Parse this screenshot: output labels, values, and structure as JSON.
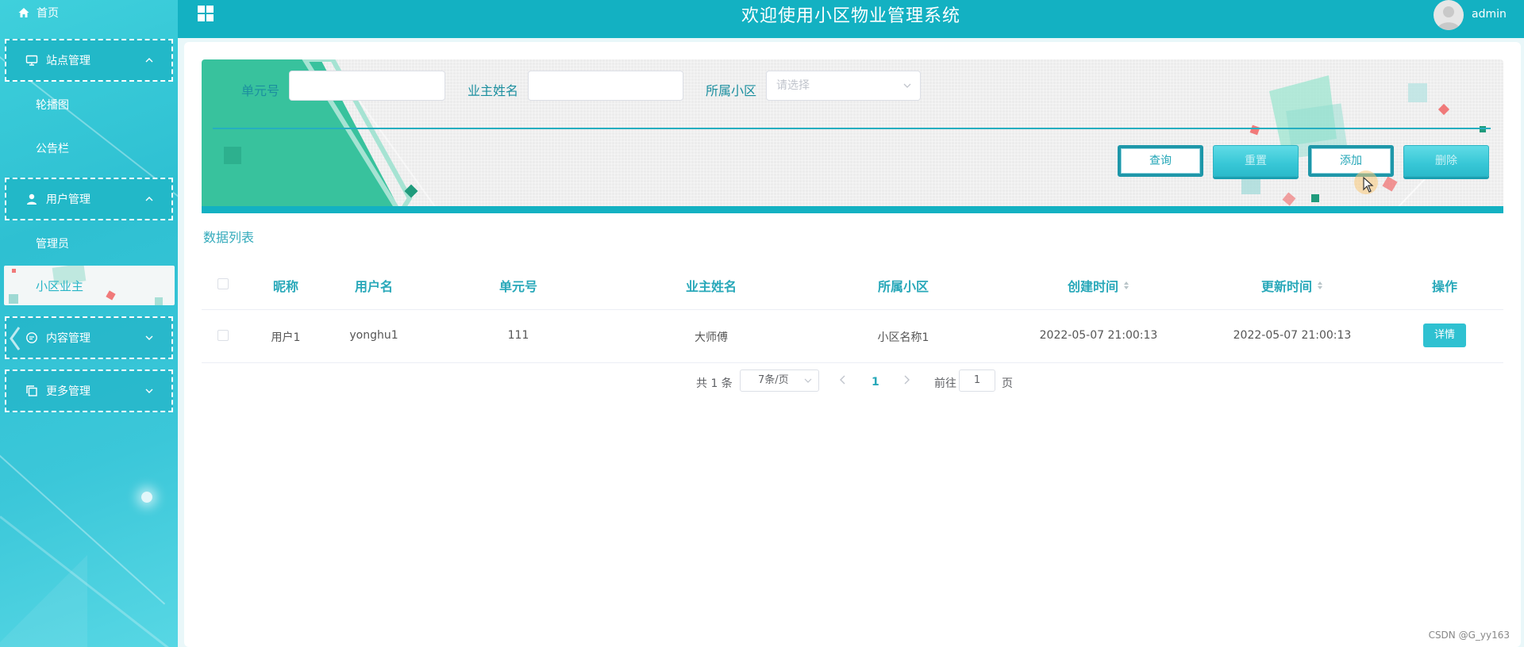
{
  "colors": {
    "primary": "#13b1c2",
    "accent": "#28a8b9",
    "sidebar_active_bg": "#f3f7f7"
  },
  "header": {
    "title": "欢迎使用小区物业管理系统",
    "username": "admin"
  },
  "sidebar": {
    "home": "首页",
    "groups": [
      {
        "label": "站点管理",
        "icon": "monitor-icon",
        "expanded": true,
        "items": [
          "轮播图",
          "公告栏"
        ]
      },
      {
        "label": "用户管理",
        "icon": "user-icon",
        "expanded": true,
        "items": [
          "管理员",
          "小区业主"
        ]
      },
      {
        "label": "内容管理",
        "icon": "chat-icon",
        "expanded": false
      },
      {
        "label": "更多管理",
        "icon": "copy-icon",
        "expanded": false
      }
    ],
    "active_item": "小区业主"
  },
  "search": {
    "fields": [
      {
        "label": "单元号",
        "value": ""
      },
      {
        "label": "业主姓名",
        "value": ""
      },
      {
        "label": "所属小区",
        "placeholder": "请选择"
      }
    ],
    "buttons": [
      "查询",
      "重置",
      "添加",
      "删除"
    ]
  },
  "list": {
    "title": "数据列表",
    "columns": [
      "昵称",
      "用户名",
      "单元号",
      "业主姓名",
      "所属小区",
      "创建时间",
      "更新时间",
      "操作"
    ],
    "rows": [
      {
        "nickname": "用户1",
        "username": "yonghu1",
        "unit": "111",
        "owner": "大师傅",
        "community": "小区名称1",
        "created": "2022-05-07 21:00:13",
        "updated": "2022-05-07 21:00:13",
        "action": "详情"
      }
    ]
  },
  "pagination": {
    "total": "共 1 条",
    "page_size": "7条/页",
    "current": "1",
    "goto_label": "前往",
    "goto_value": "1",
    "page_unit": "页"
  },
  "watermark": "CSDN @G_yy163"
}
